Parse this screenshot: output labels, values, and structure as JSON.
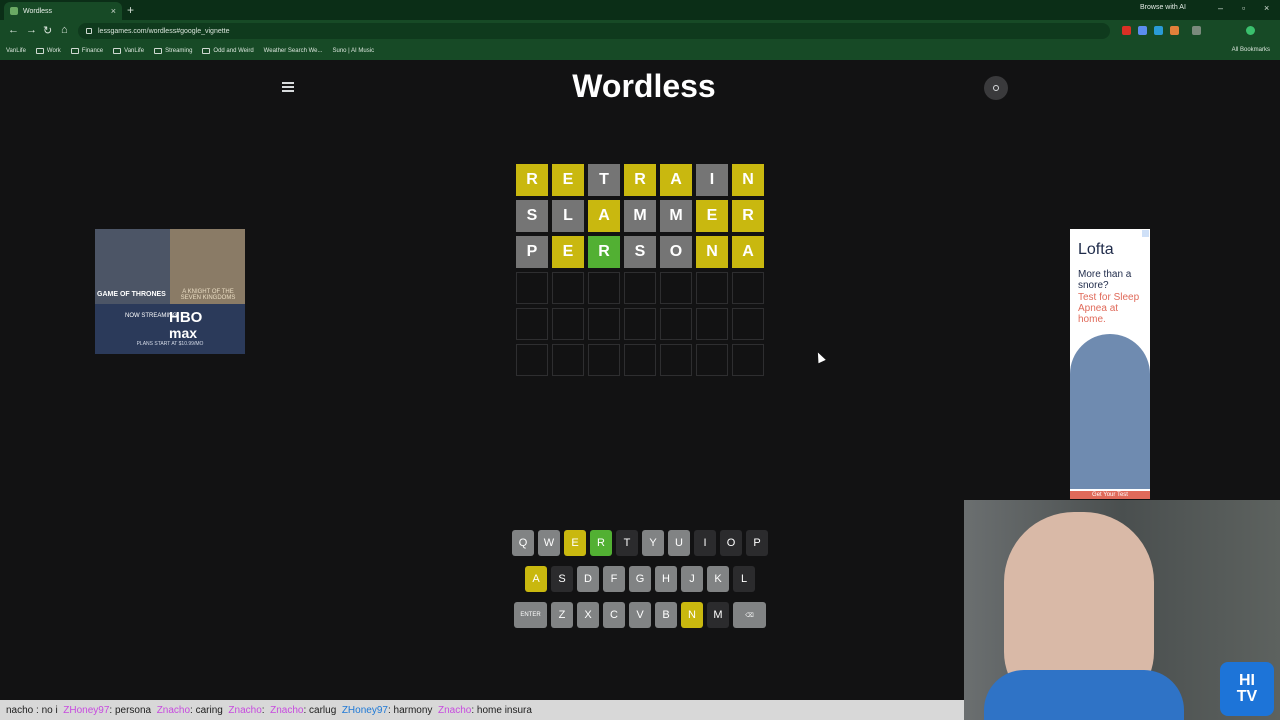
{
  "browser": {
    "tab_title": "Wordless",
    "new_tab": "+",
    "browse_ai": "Browse with AI",
    "url": "lessgames.com/wordless#google_vignette",
    "bookmarks": [
      "VanLife",
      "Work",
      "Finance",
      "VanLife",
      "Streaming",
      "Odd and Weird",
      "Weather Search We...",
      "Suno | AI Music"
    ],
    "all_bookmarks": "All Bookmarks"
  },
  "app": {
    "title": "Wordless",
    "menu_icon": "hamburger-icon",
    "profile_icon": "user-icon"
  },
  "board": {
    "rows": [
      [
        {
          "l": "R",
          "s": "y"
        },
        {
          "l": "E",
          "s": "y"
        },
        {
          "l": "T",
          "s": "x"
        },
        {
          "l": "R",
          "s": "y"
        },
        {
          "l": "A",
          "s": "y"
        },
        {
          "l": "I",
          "s": "x"
        },
        {
          "l": "N",
          "s": "y"
        }
      ],
      [
        {
          "l": "S",
          "s": "x"
        },
        {
          "l": "L",
          "s": "x"
        },
        {
          "l": "A",
          "s": "y"
        },
        {
          "l": "M",
          "s": "x"
        },
        {
          "l": "M",
          "s": "x"
        },
        {
          "l": "E",
          "s": "y"
        },
        {
          "l": "R",
          "s": "y"
        }
      ],
      [
        {
          "l": "P",
          "s": "x"
        },
        {
          "l": "E",
          "s": "y"
        },
        {
          "l": "R",
          "s": "g"
        },
        {
          "l": "S",
          "s": "x"
        },
        {
          "l": "O",
          "s": "x"
        },
        {
          "l": "N",
          "s": "y"
        },
        {
          "l": "A",
          "s": "y"
        }
      ]
    ],
    "empty_rows": 3,
    "columns": 7
  },
  "keyboard": {
    "rows": [
      [
        {
          "k": "Q",
          "s": "u"
        },
        {
          "k": "W",
          "s": "u"
        },
        {
          "k": "E",
          "s": "y"
        },
        {
          "k": "R",
          "s": "g"
        },
        {
          "k": "T",
          "s": "d"
        },
        {
          "k": "Y",
          "s": "u"
        },
        {
          "k": "U",
          "s": "u"
        },
        {
          "k": "I",
          "s": "d"
        },
        {
          "k": "O",
          "s": "d"
        },
        {
          "k": "P",
          "s": "d"
        }
      ],
      [
        {
          "k": "A",
          "s": "y"
        },
        {
          "k": "S",
          "s": "d"
        },
        {
          "k": "D",
          "s": "u"
        },
        {
          "k": "F",
          "s": "u"
        },
        {
          "k": "G",
          "s": "u"
        },
        {
          "k": "H",
          "s": "u"
        },
        {
          "k": "J",
          "s": "u"
        },
        {
          "k": "K",
          "s": "u"
        },
        {
          "k": "L",
          "s": "d"
        }
      ],
      [
        {
          "k": "ENTER",
          "s": "u",
          "wide": true
        },
        {
          "k": "Z",
          "s": "u"
        },
        {
          "k": "X",
          "s": "u"
        },
        {
          "k": "C",
          "s": "u"
        },
        {
          "k": "V",
          "s": "u"
        },
        {
          "k": "B",
          "s": "u"
        },
        {
          "k": "N",
          "s": "y"
        },
        {
          "k": "M",
          "s": "d"
        },
        {
          "k": "⌫",
          "s": "u",
          "wide": true
        }
      ]
    ]
  },
  "ads": {
    "left": {
      "title1": "GAME OF THRONES",
      "title2": "A KNIGHT OF THE SEVEN KINGDOMS",
      "now_streaming": "NOW STREAMING",
      "hbo": "HBO",
      "max": "max",
      "plans": "PLANS START AT $10.99/MO"
    },
    "right": {
      "brand": "Lofta",
      "line1": "More than a snore?",
      "line2": "Test for Sleep Apnea at home.",
      "cta": "Get Your Test"
    }
  },
  "webcam": {
    "logo_line1": "HI",
    "logo_line2": "TV"
  },
  "ticker": {
    "text1": "nacho : no i",
    "user1": "ZHoney97",
    "text2": " : persona",
    "user2": "Znacho",
    "text3": " : caring",
    "user3": "Znacho",
    "text4": " :",
    "user4": "Znacho",
    "text5": " : carlug",
    "user5": "ZHoney97",
    "text6": " : harmony",
    "user6": "Znacho",
    "text7": " : home insura"
  }
}
